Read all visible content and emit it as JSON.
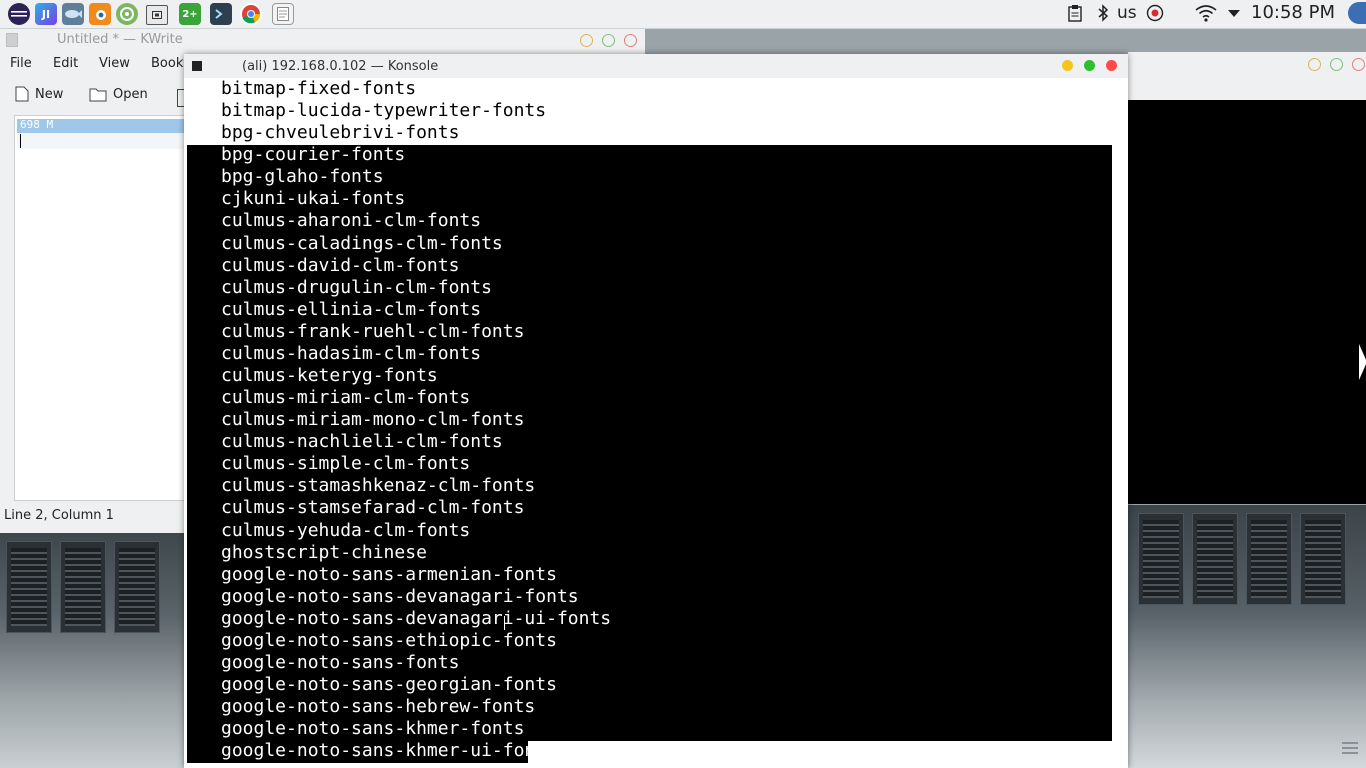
{
  "topbar": {
    "keyboard_layout": "us",
    "clock": "10:58 PM",
    "icons": [
      "eclipse-icon",
      "intellij-icon",
      "bluefish-icon",
      "blender-icon",
      "android-studio-icon",
      "screenshot-icon",
      "counter-icon",
      "terminal-icon",
      "chrome-icon",
      "text-editor-icon"
    ],
    "launcher_badge": "2+",
    "launcher_intellij": "JI",
    "tray_icons": [
      "clipboard-icon",
      "bluetooth-icon",
      "record-icon",
      "wifi-icon",
      "dropdown-icon"
    ]
  },
  "kwrite": {
    "title": "Untitled * — KWrite",
    "menu": [
      "File",
      "Edit",
      "View",
      "Book"
    ],
    "toolbar": {
      "new_label": "New",
      "open_label": "Open"
    },
    "editor_line1": "698 M",
    "status": "Line 2, Column 1"
  },
  "konsole": {
    "title": "(ali) 192.168.0.102 — Konsole",
    "lines": [
      "bitmap-fixed-fonts",
      "bitmap-lucida-typewriter-fonts",
      "bpg-chveulebrivi-fonts",
      "bpg-courier-fonts",
      "bpg-glaho-fonts",
      "cjkuni-ukai-fonts",
      "culmus-aharoni-clm-fonts",
      "culmus-caladings-clm-fonts",
      "culmus-david-clm-fonts",
      "culmus-drugulin-clm-fonts",
      "culmus-ellinia-clm-fonts",
      "culmus-frank-ruehl-clm-fonts",
      "culmus-hadasim-clm-fonts",
      "culmus-keteryg-fonts",
      "culmus-miriam-clm-fonts",
      "culmus-miriam-mono-clm-fonts",
      "culmus-nachlieli-clm-fonts",
      "culmus-simple-clm-fonts",
      "culmus-stamashkenaz-clm-fonts",
      "culmus-stamsefarad-clm-fonts",
      "culmus-yehuda-clm-fonts",
      "ghostscript-chinese",
      "google-noto-sans-armenian-fonts",
      "google-noto-sans-devanagari-fonts",
      "google-noto-sans-devanagari-ui-fonts",
      "google-noto-sans-ethiopic-fonts",
      "google-noto-sans-fonts",
      "google-noto-sans-georgian-fonts",
      "google-noto-sans-hebrew-fonts",
      "google-noto-sans-khmer-fonts",
      "google-noto-sans-khmer-ui-fonts"
    ]
  },
  "colors": {
    "selection_bg": "#000000",
    "selection_fg": "#ffffff",
    "editor_selection": "#9ec7ea",
    "btn_minimize": "#f5c518",
    "btn_maximize": "#2cc02c",
    "btn_close": "#ff4a4a"
  }
}
